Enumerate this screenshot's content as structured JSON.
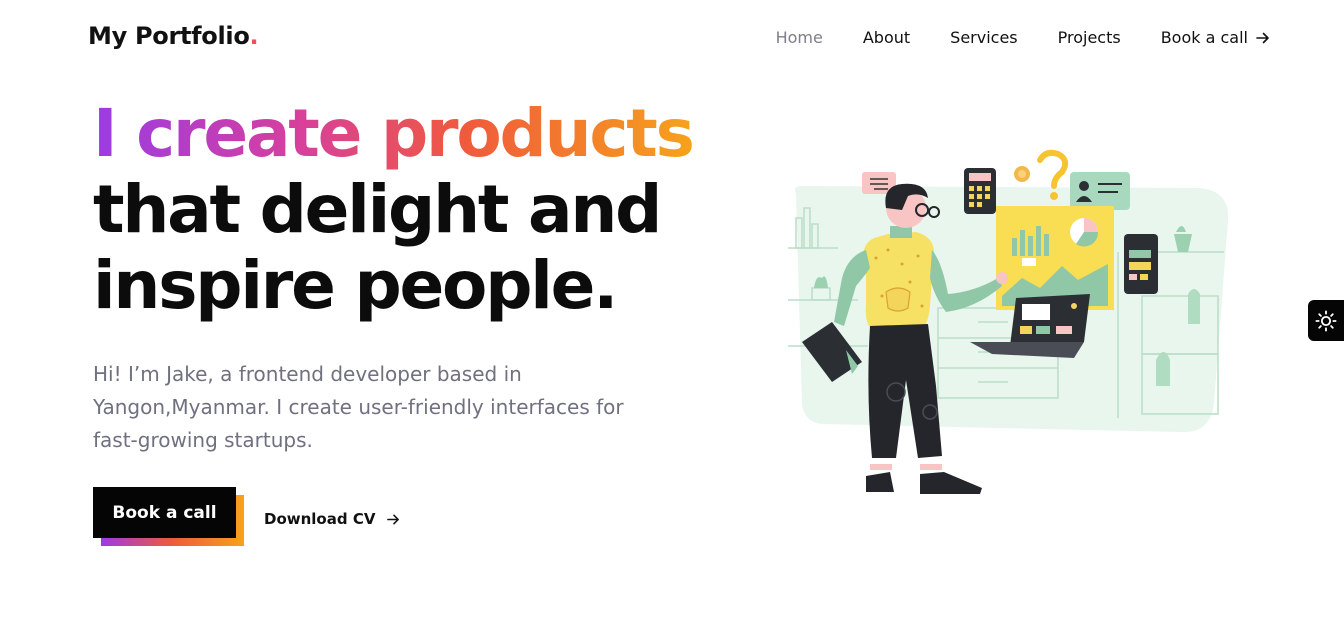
{
  "header": {
    "logo": "My Portfolio",
    "logo_dot": ".",
    "nav": [
      {
        "label": "Home",
        "active": true
      },
      {
        "label": "About"
      },
      {
        "label": "Services"
      },
      {
        "label": "Projects"
      },
      {
        "label": "Book a call",
        "icon": "arrow-right-icon"
      }
    ]
  },
  "hero": {
    "title_gradient": "I create products",
    "title_line2": "that delight and",
    "title_line3": "inspire people.",
    "intro": "Hi! I’m Jake, a frontend developer based in Yangon,Myanmar. I create user-friendly interfaces for fast-growing startups.",
    "primary_button": "Book a call",
    "secondary_button": "Download CV",
    "secondary_icon": "arrow-right-icon"
  },
  "theme_toggle": {
    "icon": "sun-icon"
  },
  "colors": {
    "gradient": [
      "#9b3be6",
      "#d8409a",
      "#f05a3c",
      "#f6a21b"
    ],
    "logo_dot": "#f24e5e",
    "nav_active": "#7d7f8a",
    "button_bg": "#050505"
  }
}
